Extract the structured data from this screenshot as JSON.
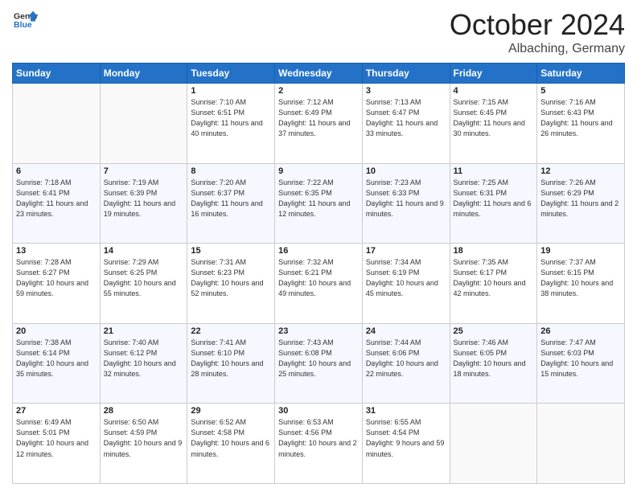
{
  "header": {
    "logo_general": "General",
    "logo_blue": "Blue",
    "month_title": "October 2024",
    "location": "Albaching, Germany"
  },
  "weekdays": [
    "Sunday",
    "Monday",
    "Tuesday",
    "Wednesday",
    "Thursday",
    "Friday",
    "Saturday"
  ],
  "weeks": [
    [
      {
        "day": "",
        "sunrise": "",
        "sunset": "",
        "daylight": ""
      },
      {
        "day": "",
        "sunrise": "",
        "sunset": "",
        "daylight": ""
      },
      {
        "day": "1",
        "sunrise": "Sunrise: 7:10 AM",
        "sunset": "Sunset: 6:51 PM",
        "daylight": "Daylight: 11 hours and 40 minutes."
      },
      {
        "day": "2",
        "sunrise": "Sunrise: 7:12 AM",
        "sunset": "Sunset: 6:49 PM",
        "daylight": "Daylight: 11 hours and 37 minutes."
      },
      {
        "day": "3",
        "sunrise": "Sunrise: 7:13 AM",
        "sunset": "Sunset: 6:47 PM",
        "daylight": "Daylight: 11 hours and 33 minutes."
      },
      {
        "day": "4",
        "sunrise": "Sunrise: 7:15 AM",
        "sunset": "Sunset: 6:45 PM",
        "daylight": "Daylight: 11 hours and 30 minutes."
      },
      {
        "day": "5",
        "sunrise": "Sunrise: 7:16 AM",
        "sunset": "Sunset: 6:43 PM",
        "daylight": "Daylight: 11 hours and 26 minutes."
      }
    ],
    [
      {
        "day": "6",
        "sunrise": "Sunrise: 7:18 AM",
        "sunset": "Sunset: 6:41 PM",
        "daylight": "Daylight: 11 hours and 23 minutes."
      },
      {
        "day": "7",
        "sunrise": "Sunrise: 7:19 AM",
        "sunset": "Sunset: 6:39 PM",
        "daylight": "Daylight: 11 hours and 19 minutes."
      },
      {
        "day": "8",
        "sunrise": "Sunrise: 7:20 AM",
        "sunset": "Sunset: 6:37 PM",
        "daylight": "Daylight: 11 hours and 16 minutes."
      },
      {
        "day": "9",
        "sunrise": "Sunrise: 7:22 AM",
        "sunset": "Sunset: 6:35 PM",
        "daylight": "Daylight: 11 hours and 12 minutes."
      },
      {
        "day": "10",
        "sunrise": "Sunrise: 7:23 AM",
        "sunset": "Sunset: 6:33 PM",
        "daylight": "Daylight: 11 hours and 9 minutes."
      },
      {
        "day": "11",
        "sunrise": "Sunrise: 7:25 AM",
        "sunset": "Sunset: 6:31 PM",
        "daylight": "Daylight: 11 hours and 6 minutes."
      },
      {
        "day": "12",
        "sunrise": "Sunrise: 7:26 AM",
        "sunset": "Sunset: 6:29 PM",
        "daylight": "Daylight: 11 hours and 2 minutes."
      }
    ],
    [
      {
        "day": "13",
        "sunrise": "Sunrise: 7:28 AM",
        "sunset": "Sunset: 6:27 PM",
        "daylight": "Daylight: 10 hours and 59 minutes."
      },
      {
        "day": "14",
        "sunrise": "Sunrise: 7:29 AM",
        "sunset": "Sunset: 6:25 PM",
        "daylight": "Daylight: 10 hours and 55 minutes."
      },
      {
        "day": "15",
        "sunrise": "Sunrise: 7:31 AM",
        "sunset": "Sunset: 6:23 PM",
        "daylight": "Daylight: 10 hours and 52 minutes."
      },
      {
        "day": "16",
        "sunrise": "Sunrise: 7:32 AM",
        "sunset": "Sunset: 6:21 PM",
        "daylight": "Daylight: 10 hours and 49 minutes."
      },
      {
        "day": "17",
        "sunrise": "Sunrise: 7:34 AM",
        "sunset": "Sunset: 6:19 PM",
        "daylight": "Daylight: 10 hours and 45 minutes."
      },
      {
        "day": "18",
        "sunrise": "Sunrise: 7:35 AM",
        "sunset": "Sunset: 6:17 PM",
        "daylight": "Daylight: 10 hours and 42 minutes."
      },
      {
        "day": "19",
        "sunrise": "Sunrise: 7:37 AM",
        "sunset": "Sunset: 6:15 PM",
        "daylight": "Daylight: 10 hours and 38 minutes."
      }
    ],
    [
      {
        "day": "20",
        "sunrise": "Sunrise: 7:38 AM",
        "sunset": "Sunset: 6:14 PM",
        "daylight": "Daylight: 10 hours and 35 minutes."
      },
      {
        "day": "21",
        "sunrise": "Sunrise: 7:40 AM",
        "sunset": "Sunset: 6:12 PM",
        "daylight": "Daylight: 10 hours and 32 minutes."
      },
      {
        "day": "22",
        "sunrise": "Sunrise: 7:41 AM",
        "sunset": "Sunset: 6:10 PM",
        "daylight": "Daylight: 10 hours and 28 minutes."
      },
      {
        "day": "23",
        "sunrise": "Sunrise: 7:43 AM",
        "sunset": "Sunset: 6:08 PM",
        "daylight": "Daylight: 10 hours and 25 minutes."
      },
      {
        "day": "24",
        "sunrise": "Sunrise: 7:44 AM",
        "sunset": "Sunset: 6:06 PM",
        "daylight": "Daylight: 10 hours and 22 minutes."
      },
      {
        "day": "25",
        "sunrise": "Sunrise: 7:46 AM",
        "sunset": "Sunset: 6:05 PM",
        "daylight": "Daylight: 10 hours and 18 minutes."
      },
      {
        "day": "26",
        "sunrise": "Sunrise: 7:47 AM",
        "sunset": "Sunset: 6:03 PM",
        "daylight": "Daylight: 10 hours and 15 minutes."
      }
    ],
    [
      {
        "day": "27",
        "sunrise": "Sunrise: 6:49 AM",
        "sunset": "Sunset: 5:01 PM",
        "daylight": "Daylight: 10 hours and 12 minutes."
      },
      {
        "day": "28",
        "sunrise": "Sunrise: 6:50 AM",
        "sunset": "Sunset: 4:59 PM",
        "daylight": "Daylight: 10 hours and 9 minutes."
      },
      {
        "day": "29",
        "sunrise": "Sunrise: 6:52 AM",
        "sunset": "Sunset: 4:58 PM",
        "daylight": "Daylight: 10 hours and 6 minutes."
      },
      {
        "day": "30",
        "sunrise": "Sunrise: 6:53 AM",
        "sunset": "Sunset: 4:56 PM",
        "daylight": "Daylight: 10 hours and 2 minutes."
      },
      {
        "day": "31",
        "sunrise": "Sunrise: 6:55 AM",
        "sunset": "Sunset: 4:54 PM",
        "daylight": "Daylight: 9 hours and 59 minutes."
      },
      {
        "day": "",
        "sunrise": "",
        "sunset": "",
        "daylight": ""
      },
      {
        "day": "",
        "sunrise": "",
        "sunset": "",
        "daylight": ""
      }
    ]
  ]
}
